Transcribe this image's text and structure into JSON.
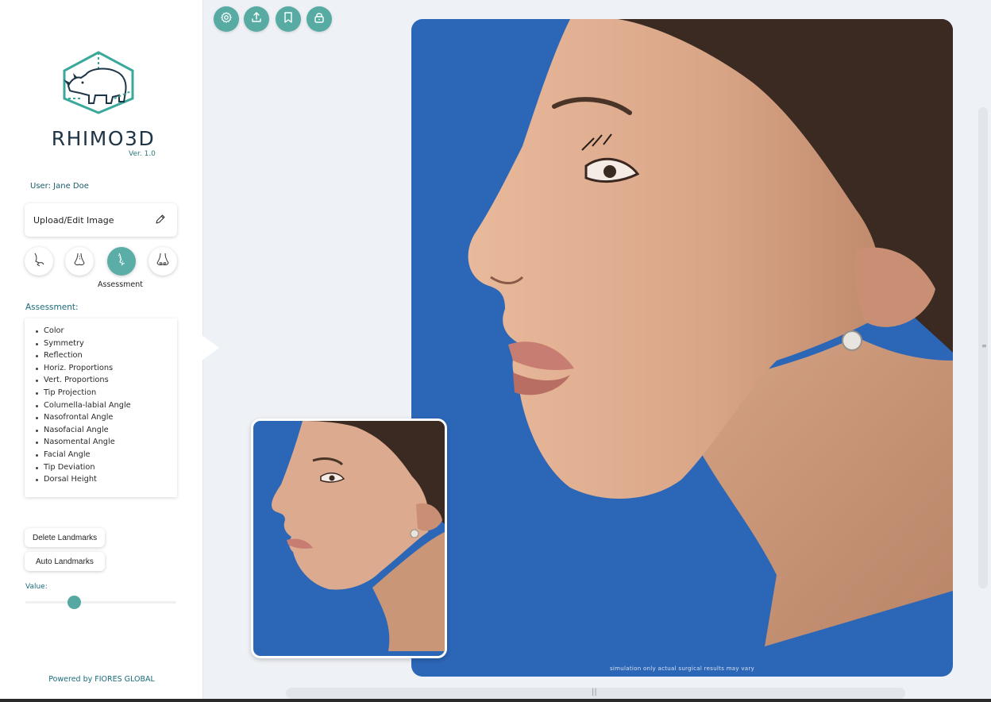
{
  "app": {
    "title": "RHIMO3D",
    "version": "Ver. 1.0",
    "brand_color": "#5aaea7",
    "title_color": "#1e3447"
  },
  "user": {
    "label": "User: Jane Doe"
  },
  "upload": {
    "label": "Upload/Edit Image",
    "icon": "pencil-icon"
  },
  "tools": {
    "items": [
      {
        "icon": "nose-profile-icon",
        "active": false
      },
      {
        "icon": "nose-front-icon",
        "active": false
      },
      {
        "icon": "nose-assessment-icon",
        "active": true
      },
      {
        "icon": "nose-base-icon",
        "active": false
      }
    ],
    "active_label": "Assessment"
  },
  "assessment": {
    "heading": "Assessment:",
    "items": [
      "Color",
      "Symmetry",
      "Reflection",
      "Horiz. Proportions",
      "Vert. Proportions",
      "Tip Projection",
      "Columella-labial Angle",
      "Nasofrontal Angle",
      "Nasofacial Angle",
      "Nasomental Angle",
      "Facial Angle",
      "Tip Deviation",
      "Dorsal Height"
    ]
  },
  "actions": {
    "delete_landmarks": "Delete Landmarks",
    "auto_landmarks": "Auto Landmarks"
  },
  "slider": {
    "label": "Value:",
    "value": 0.32
  },
  "footer": {
    "powered_by": "Powered by FIORES GLOBAL"
  },
  "toolbar": {
    "icons": [
      "settings-icon",
      "upload-icon",
      "bookmark-icon",
      "lock-icon"
    ]
  },
  "image": {
    "caption": "simulation only actual surgical results may vary",
    "background_color": "#2c66b6"
  }
}
